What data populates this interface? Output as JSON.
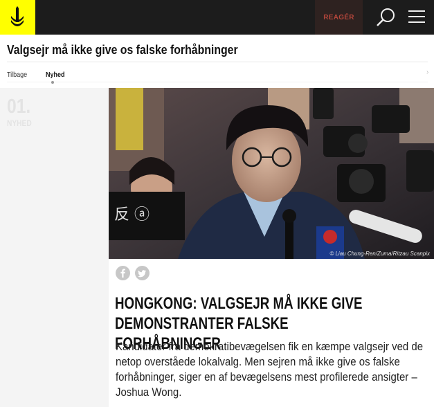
{
  "header": {
    "react_label": "REAGÉR",
    "icons": [
      "amnesty-candle-logo",
      "search-icon",
      "menu-icon"
    ],
    "colors": {
      "bar": "#1c1c1c",
      "logo": "#ffff00",
      "react_bg": "#2e2220",
      "react_text": "#b4463b"
    }
  },
  "article_title": "Valgsejr må ikke give os falske forhåbninger",
  "crumbs": {
    "back": "Tilbage",
    "current": "Nyhed"
  },
  "sidebar": {
    "number": "01.",
    "kind": "NYHED"
  },
  "hero": {
    "credit": "© Liau Chung-Ren/Zuma/Ritzau Scanpix"
  },
  "share": [
    "facebook-icon",
    "twitter-icon"
  ],
  "headline": [
    "HONGKONG: VALGSEJR MÅ IKKE GIVE",
    "DEMONSTRANTER FALSKE FORHÅBNINGER"
  ],
  "lead": "Kandidater fra demokratibevægelsen fik en kæmpe valgsejr ved de netop overståede lokalvalg. Men sejren må ikke give os falske forhåbninger, siger en af bevægelsens mest profilerede ansigter – Joshua Wong."
}
